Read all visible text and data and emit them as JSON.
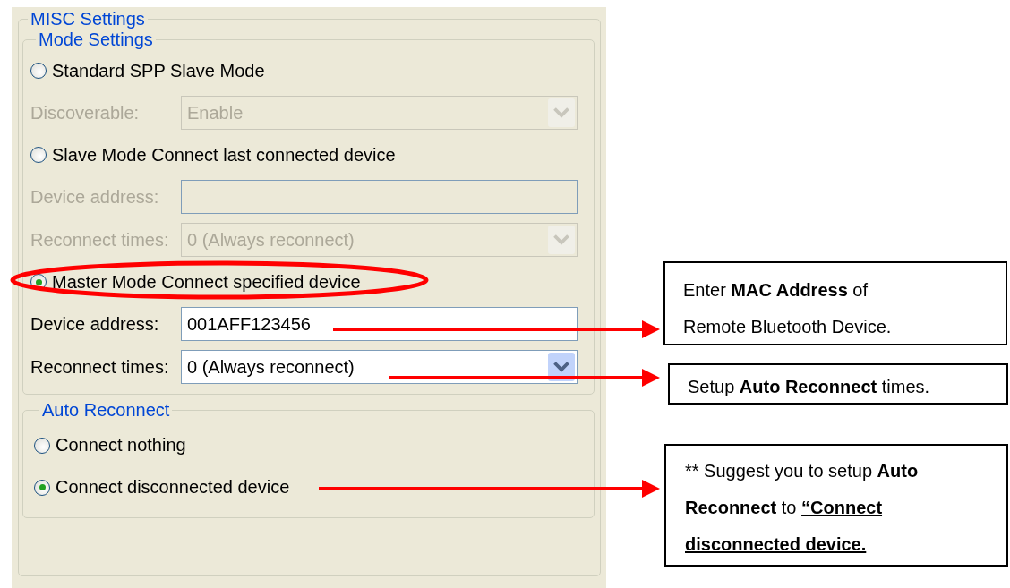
{
  "misc_group": {
    "title": "MISC Settings"
  },
  "mode_group": {
    "title": "Mode Settings",
    "options": [
      {
        "label": "Standard SPP Slave Mode",
        "selected": false,
        "highlighted": false,
        "fields": [
          {
            "kind": "select",
            "label": "Discoverable:",
            "value": "Enable",
            "disabled": true
          }
        ]
      },
      {
        "label": "Slave Mode Connect last connected device",
        "selected": false,
        "highlighted": false,
        "fields": [
          {
            "kind": "input",
            "label": "Device address:",
            "disabled": true
          },
          {
            "kind": "select",
            "label": "Reconnect times:",
            "value": "0 (Always reconnect)",
            "disabled": true
          }
        ]
      },
      {
        "label": "Master Mode Connect specified device",
        "selected": true,
        "highlighted": true,
        "fields": [
          {
            "kind": "input",
            "label": "Device address:",
            "value": "001AFF123456",
            "disabled": false
          },
          {
            "kind": "select",
            "label": "Reconnect times:",
            "value": "0 (Always reconnect)",
            "disabled": false
          }
        ]
      }
    ]
  },
  "auto_reconnect": {
    "title": "Auto Reconnect",
    "options": [
      {
        "label": "Connect nothing",
        "selected": false
      },
      {
        "label": "Connect disconnected device",
        "selected": true
      }
    ]
  },
  "callouts": [
    {
      "lines": [
        [
          {
            "text": "Enter "
          },
          {
            "text": "MAC Address",
            "bold": true
          },
          {
            "text": " of"
          }
        ],
        [
          {
            "text": "Remote Bluetooth Device."
          }
        ]
      ]
    },
    {
      "lines": [
        [
          {
            "text": "Setup "
          },
          {
            "text": "Auto Reconnect",
            "bold": true
          },
          {
            "text": " times."
          }
        ]
      ]
    },
    {
      "lines": [
        [
          {
            "text": "** Suggest you to setup "
          },
          {
            "text": "Auto",
            "bold": true
          }
        ],
        [
          {
            "text": "Reconnect",
            "bold": true
          },
          {
            "text": " to "
          },
          {
            "text": "“Connect ",
            "bold": true,
            "underline": true
          }
        ],
        [
          {
            "text": "disconnected device.",
            "bold": true,
            "underline": true
          }
        ]
      ]
    }
  ]
}
